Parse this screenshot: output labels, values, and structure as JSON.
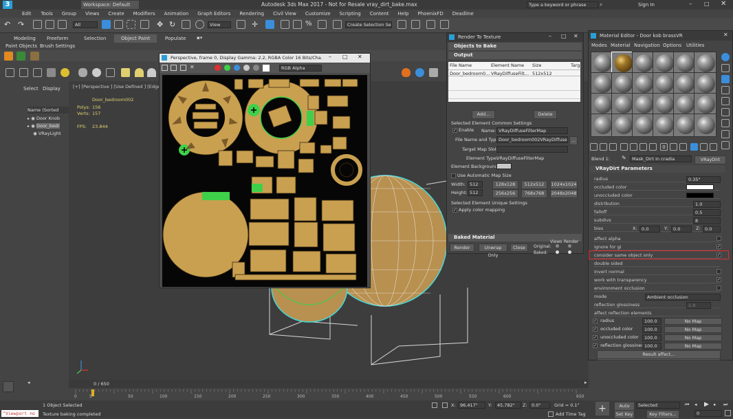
{
  "app": {
    "title": "Autodesk 3ds Max 2017 - Not for Resale    vray_dirt_bake.max",
    "workspace": "Workspace: Default",
    "search_placeholder": "Type a keyword or phrase",
    "sign_in": "Sign In"
  },
  "menu": [
    "Edit",
    "Tools",
    "Group",
    "Views",
    "Create",
    "Modifiers",
    "Animation",
    "Graph Editors",
    "Rendering",
    "Civil View",
    "Customize",
    "Scripting",
    "Content",
    "Help",
    "PhoenixFD",
    "Deadline"
  ],
  "toolbar": {
    "selection_filter": "All",
    "view_dropdown": "View",
    "named_selection": "Create Selection Se"
  },
  "ribbon_tabs": [
    "Modeling",
    "Freeform",
    "Selection",
    "Object Paint",
    "Populate"
  ],
  "ribbon_subtabs": [
    "Paint Objects",
    "Brush Settings"
  ],
  "scene_explorer": {
    "tabs": [
      "Select",
      "Display"
    ],
    "column": "Name (Sorted Ascen",
    "items": [
      "Door Knob",
      "Door_bedr",
      "VRayLight"
    ]
  },
  "viewport": {
    "label": "[+] [Perspective ] [Use Defined ] [Edged F",
    "object_name": "Door_bedroom002",
    "polys_label": "Polys:",
    "polys": "156",
    "verts_label": "Verts:",
    "verts": "157",
    "fps_label": "FPS:",
    "fps": "23.844"
  },
  "frame_window": {
    "title": "Perspective, frame 0, Display Gamma: 2.2, RGBA Color 16 Bits/Cha...",
    "channel": "RGB Alpha"
  },
  "rtt": {
    "title": "Render To Texture",
    "objects_to_bake": "Objects to Bake",
    "output": "Output",
    "columns": [
      "File Name",
      "Element Name",
      "Size",
      "Targ"
    ],
    "row": [
      "Door_bedroom0...",
      "VRayDiffuseFilt...",
      "512x512"
    ],
    "add": "Add...",
    "delete": "Delete",
    "common_settings": "Selected Element Common Settings",
    "enable": "Enable",
    "name_label": "Name:",
    "name_value": "VRayDiffuseFilterMap",
    "file_label": "File Name and Type:",
    "file_value": "Door_bedroom002VRayDiffuseFilte",
    "browse": "...",
    "target_slot": "Target Map Slot:",
    "element_type_label": "Element Type:",
    "element_type": "VRayDiffuseFilterMap",
    "element_bg": "Element Background:",
    "auto_size": "Use Automatic Map Size",
    "width_label": "Width:",
    "width": "512",
    "height_label": "Height:",
    "height": "512",
    "presets": [
      "128x128",
      "512x512",
      "1024x1024",
      "256x256",
      "768x768",
      "2048x2048"
    ],
    "unique_settings": "Selected Element Unique Settings",
    "apply_color": "Apply color mapping",
    "baked_material": "Baked Material",
    "render": "Render",
    "unwrap": "Unwrap Only",
    "close": "Close",
    "views": "Views",
    "render_col": "Render",
    "original": "Original:",
    "baked": "Baked:"
  },
  "mat_editor": {
    "title": "Material Editor - Door kob brassVR",
    "menu": [
      "Modes",
      "Material",
      "Navigation",
      "Options",
      "Utilities"
    ],
    "map_name_label": "Blend 1:",
    "map_name": "Mask_Dirt in cradia",
    "map_type": "VRayDirt",
    "rollout": "VRayDirt Parameters",
    "params": [
      {
        "label": "radius",
        "value": "0.35\""
      },
      {
        "label": "occluded color",
        "value": ""
      },
      {
        "label": "unoccluded color",
        "value": ""
      },
      {
        "label": "distribution",
        "value": "1.0"
      },
      {
        "label": "falloff",
        "value": "0.5"
      },
      {
        "label": "subdivs",
        "value": "8"
      }
    ],
    "bias_label": "bias",
    "bias_x": "0.0",
    "bias_y": "0.0",
    "bias_z": "0.0",
    "flags": [
      "affect alpha",
      "ignore for gi",
      "consider same object only",
      "double sided",
      "invert normal",
      "work with transparency",
      "environment occlusion"
    ],
    "mode_label": "mode",
    "mode_value": "Ambient occlusion",
    "refl_gloss": "reflection glossiness",
    "refl_gloss_value": "1.0",
    "affect_refl": "affect reflection elements",
    "maps": [
      {
        "label": "radius",
        "value": "100.0",
        "map": "No Map"
      },
      {
        "label": "occluded color",
        "value": "100.0",
        "map": "No Map"
      },
      {
        "label": "unoccluded color",
        "value": "100.0",
        "map": "No Map"
      },
      {
        "label": "reflection glossines",
        "value": "100.0",
        "map": "No Map"
      }
    ],
    "exclude": "Exclude...",
    "result_affect": "Result affect..."
  },
  "timeline": {
    "frame": "0 / 650",
    "ticks": [
      "0",
      "5",
      "50",
      "100",
      "150",
      "200",
      "250",
      "300",
      "350",
      "400",
      "450",
      "500",
      "550",
      "600",
      "650"
    ]
  },
  "status": {
    "script": "\"Viewport no",
    "selected": "1 Object Selected",
    "message": "Texture baking completed",
    "x_label": "X:",
    "x": "96.417\"",
    "y_label": "Y:",
    "y": "45.782\"",
    "z_label": "Z:",
    "z": "0.0\"",
    "grid": "Grid = 0.1\"",
    "add_time_tag": "Add Time Tag",
    "auto_key": "Auto Key",
    "selected_dd": "Selected",
    "set_key": "Set Key",
    "key_filters": "Key Filters...",
    "frame_field": "0"
  },
  "colors": {
    "accent": "#3b8edb",
    "uv_fill": "#c9a050",
    "uv_green": "#3fd04a",
    "highlight_box": "#e03030"
  }
}
